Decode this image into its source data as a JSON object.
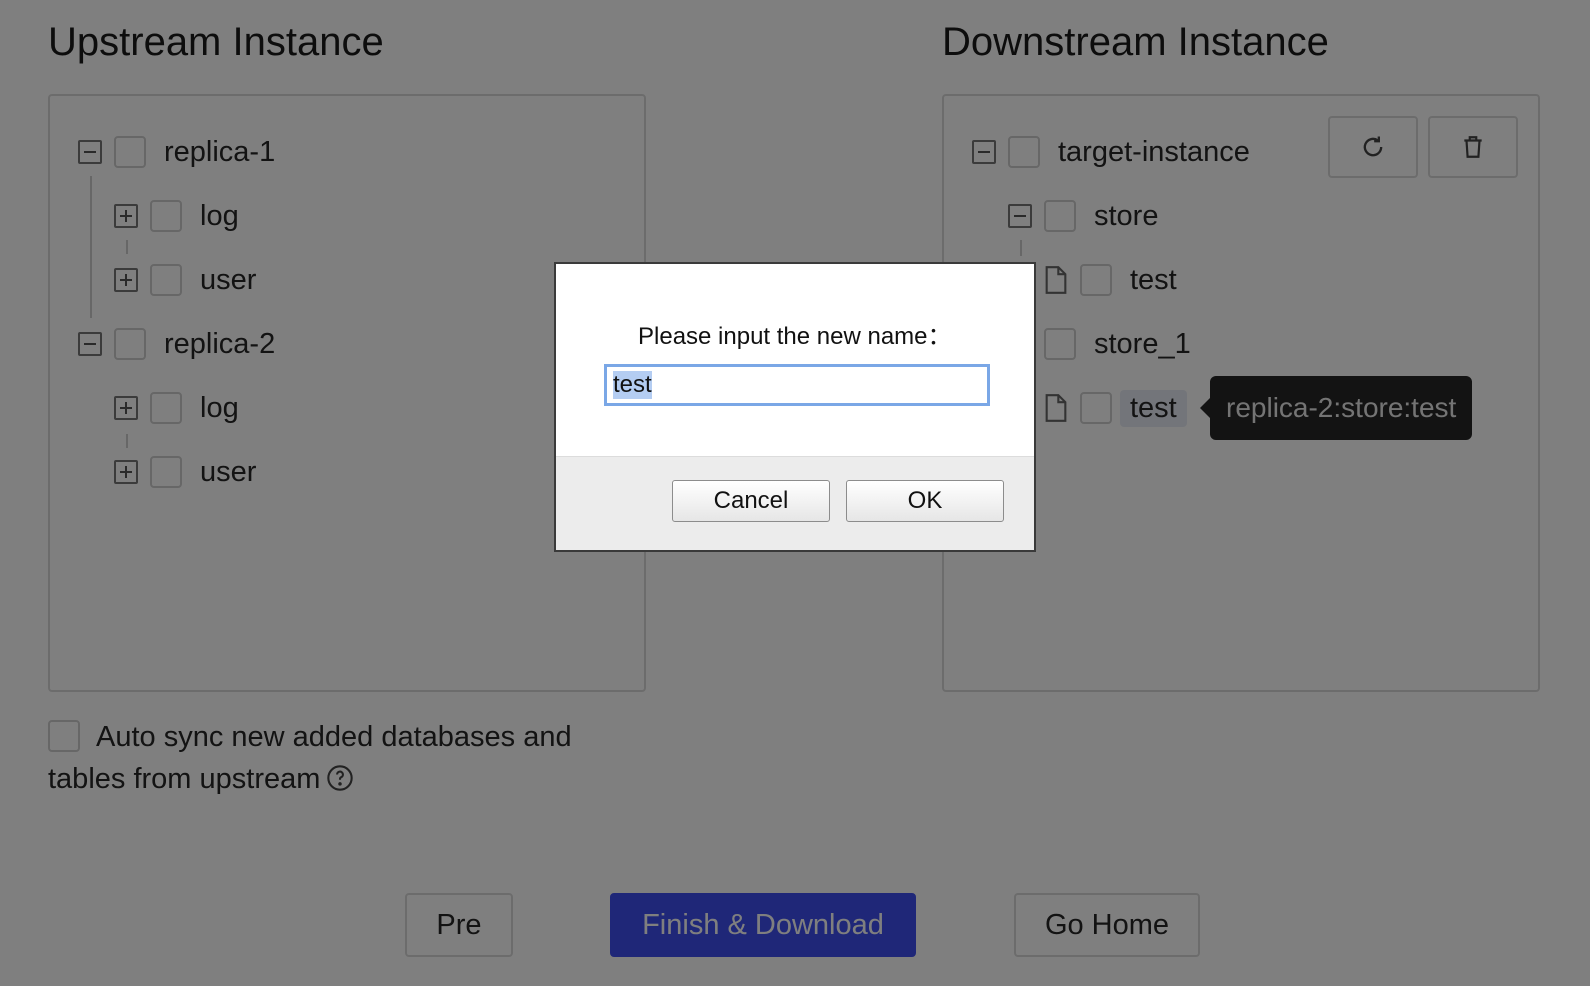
{
  "upstream": {
    "title": "Upstream Instance",
    "tree": [
      {
        "label": "replica-1",
        "children": [
          {
            "label": "log"
          },
          {
            "label": "user"
          }
        ]
      },
      {
        "label": "replica-2",
        "children": [
          {
            "label": "log"
          },
          {
            "label": "user"
          }
        ]
      }
    ]
  },
  "downstream": {
    "title": "Downstream Instance",
    "root": "target-instance",
    "tree": [
      {
        "label": "store",
        "children": [
          {
            "label": "test"
          }
        ]
      },
      {
        "label": "store_1",
        "children": [
          {
            "label": "test"
          }
        ]
      }
    ],
    "toolbar": {
      "refresh_icon": "refresh-icon",
      "delete_icon": "trash-icon"
    }
  },
  "tooltip": "replica-2:store:test",
  "auto_sync": {
    "line1": "Auto sync new added databases and",
    "line2": "tables from upstream",
    "help_icon": "question-circle-icon"
  },
  "footer": {
    "pre": "Pre",
    "finish": "Finish & Download",
    "home": "Go Home"
  },
  "dialog": {
    "message": "Please input the new name：",
    "input_value": "test",
    "cancel": "Cancel",
    "ok": "OK"
  },
  "colors": {
    "primary": "#3e4ff0",
    "tooltip_bg": "#262626",
    "overlay": "rgba(0,0,0,0.5)"
  }
}
